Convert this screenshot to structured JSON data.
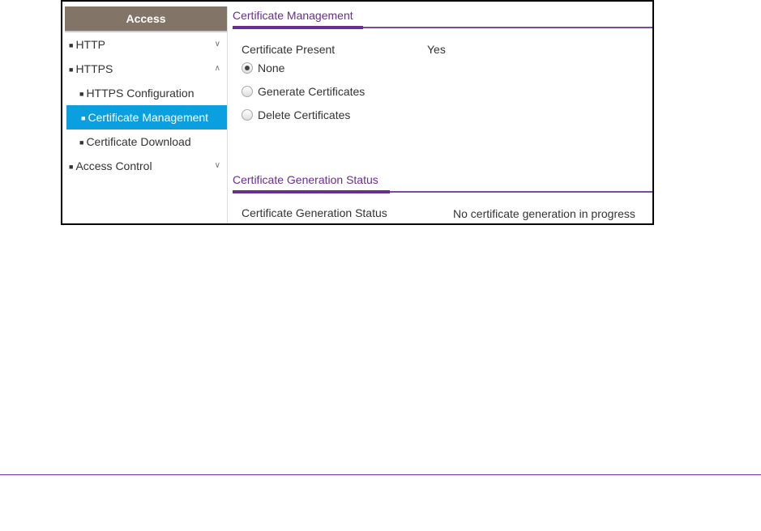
{
  "sidebar": {
    "title": "Access",
    "items": [
      {
        "label": "HTTP",
        "chevron": "chevron-down-icon"
      },
      {
        "label": "HTTPS",
        "chevron": "chevron-up-icon"
      },
      {
        "label": "HTTPS Configuration"
      },
      {
        "label": "Certificate Management",
        "active": true
      },
      {
        "label": "Certificate Download"
      },
      {
        "label": "Access Control",
        "chevron": "chevron-down-icon"
      }
    ]
  },
  "management": {
    "title": "Certificate Management",
    "present_label": "Certificate Present",
    "present_value": "Yes",
    "options": [
      {
        "label": "None",
        "selected": true
      },
      {
        "label": "Generate Certificates",
        "selected": false
      },
      {
        "label": "Delete Certificates",
        "selected": false
      }
    ]
  },
  "status": {
    "title": "Certificate Generation Status",
    "label": "Certificate Generation Status",
    "value": "No certificate generation in progress"
  },
  "colors": {
    "accent": "#6a2d91",
    "active": "#0aa0e0",
    "header": "#837468"
  }
}
